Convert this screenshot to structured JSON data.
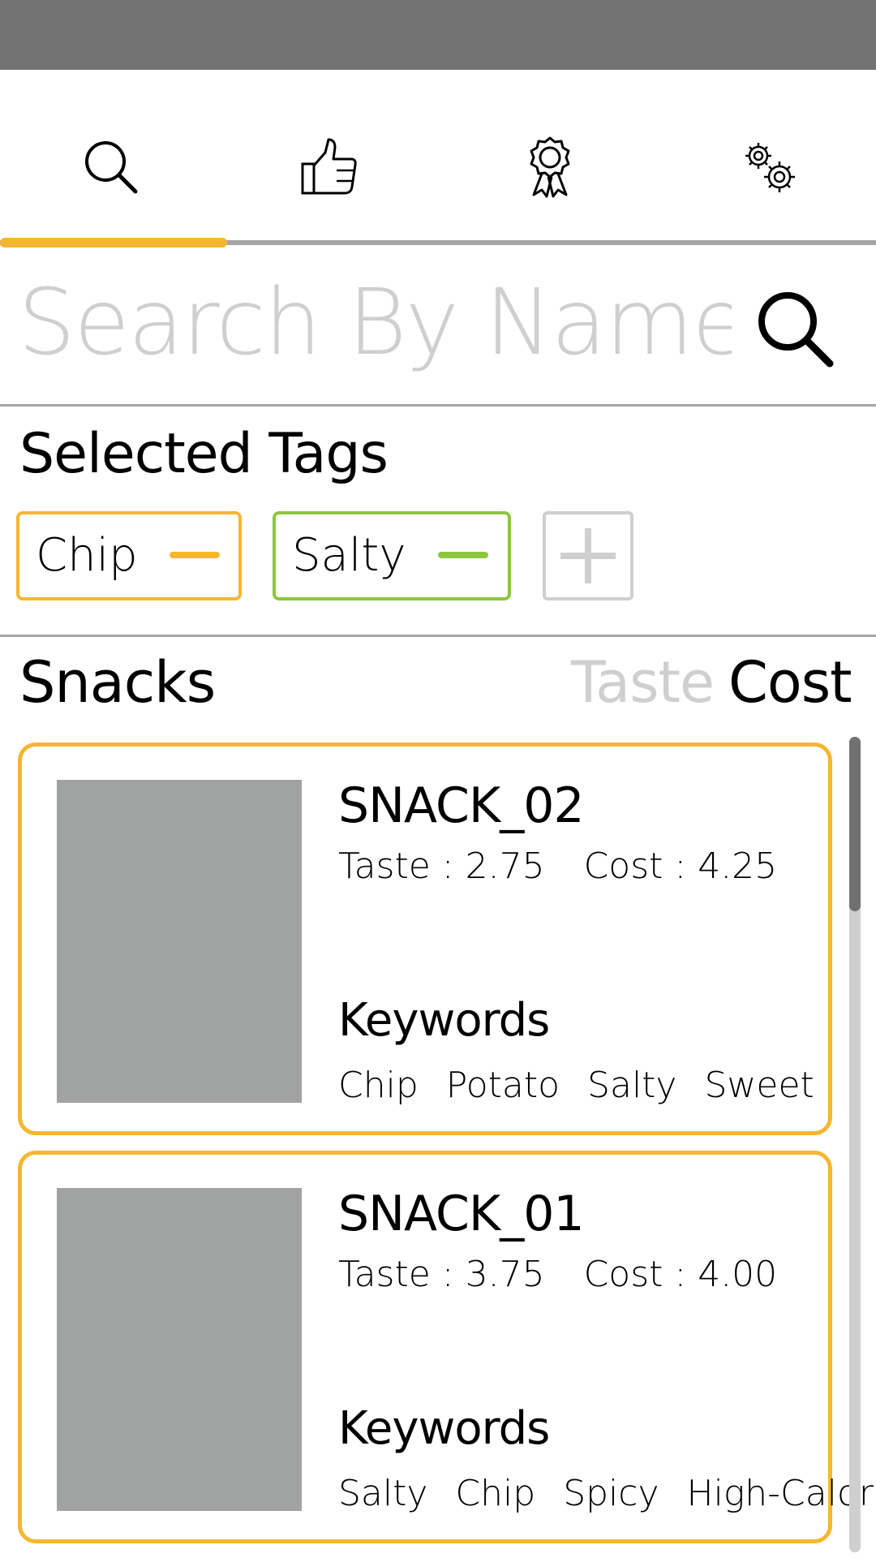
{
  "colors": {
    "accent": "#f5b731",
    "green": "#8cc63f",
    "muted": "#cfcfcf",
    "divider": "#a6a6a6",
    "status_bar": "#727272",
    "image_placeholder": "#a1a2a2"
  },
  "tabs": [
    {
      "icon": "search-icon",
      "active": true
    },
    {
      "icon": "thumbs-up-icon",
      "active": false
    },
    {
      "icon": "award-icon",
      "active": false
    },
    {
      "icon": "gears-icon",
      "active": false
    }
  ],
  "search": {
    "placeholder": "Search By Name",
    "value": "",
    "button_icon": "search-icon"
  },
  "selected_tags": {
    "title": "Selected Tags",
    "items": [
      {
        "label": "Chip",
        "color": "#f5b731"
      },
      {
        "label": "Salty",
        "color": "#8cc63f"
      }
    ],
    "add_icon": "plus-icon"
  },
  "snacks": {
    "title": "Snacks",
    "sort_options": [
      {
        "label": "Taste",
        "active": false
      },
      {
        "label": "Cost",
        "active": true
      }
    ],
    "items": [
      {
        "name": "SNACK_02",
        "taste": "Taste : 2.75",
        "cost": "Cost : 4.25",
        "keywords_label": "Keywords",
        "keywords": [
          "Chip",
          "Potato",
          "Salty",
          "Sweet"
        ]
      },
      {
        "name": "SNACK_01",
        "taste": "Taste : 3.75",
        "cost": "Cost : 4.00",
        "keywords_label": "Keywords",
        "keywords": [
          "Salty",
          "Chip",
          "Spicy",
          "High-Calorie"
        ]
      }
    ]
  }
}
